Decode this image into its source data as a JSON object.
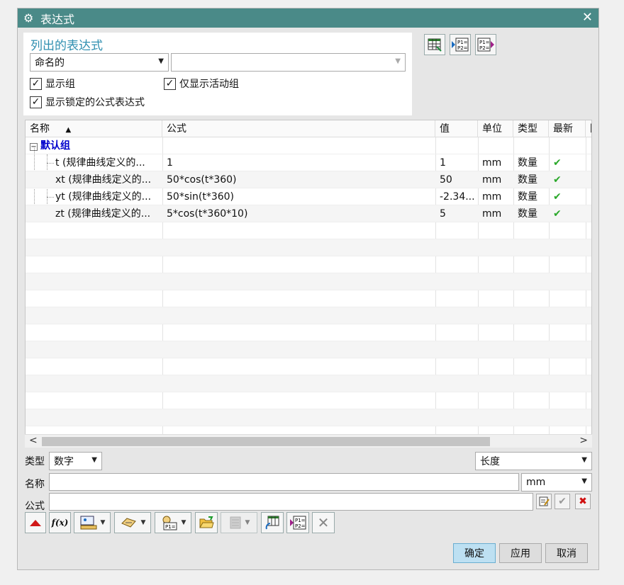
{
  "window": {
    "title": "表达式",
    "gear_icon": "⚙",
    "close_icon": "✕"
  },
  "list_section": {
    "title": "列出的表达式",
    "filter_value": "命名的",
    "search_value": "",
    "checkboxes": {
      "show_groups": "显示组",
      "show_active_group_only": "仅显示活动组",
      "show_locked": "显示锁定的公式表达式"
    }
  },
  "table": {
    "columns": [
      "名称",
      "公式",
      "值",
      "单位",
      "类型",
      "最新",
      "附"
    ],
    "sort_indicator": "▲",
    "group": {
      "toggle": "−",
      "label": "默认组"
    },
    "rows": [
      {
        "name": "t  (规律曲线定义的...",
        "formula": "1",
        "value": "1",
        "unit": "mm",
        "type": "数量",
        "latest": "✔"
      },
      {
        "name": "xt  (规律曲线定义的...",
        "formula": "50*cos(t*360)",
        "value": "50",
        "unit": "mm",
        "type": "数量",
        "latest": "✔"
      },
      {
        "name": "yt  (规律曲线定义的...",
        "formula": "50*sin(t*360)",
        "value": "-2.34...",
        "unit": "mm",
        "type": "数量",
        "latest": "✔"
      },
      {
        "name": "zt  (规律曲线定义的...",
        "formula": "5*cos(t*360*10)",
        "value": "5",
        "unit": "mm",
        "type": "数量",
        "latest": "✔"
      }
    ],
    "scroll_left": "<",
    "scroll_right": ">"
  },
  "editor": {
    "type_label": "类型",
    "type_value": "数字",
    "dimension_value": "长度",
    "name_label": "名称",
    "name_value": "",
    "unit_value": "mm",
    "formula_label": "公式",
    "formula_value": "",
    "accept_icon": "✔",
    "reject_icon": "✖"
  },
  "toolbar": {
    "fx_label": "f(x)"
  },
  "buttons": {
    "ok": "确定",
    "apply": "应用",
    "cancel": "取消"
  },
  "colors": {
    "titlebar": "#4a8a88",
    "section_title": "#2f8fb0",
    "group": "#0000cc",
    "check": "#2aa82a",
    "primary": "#bde0f2"
  }
}
